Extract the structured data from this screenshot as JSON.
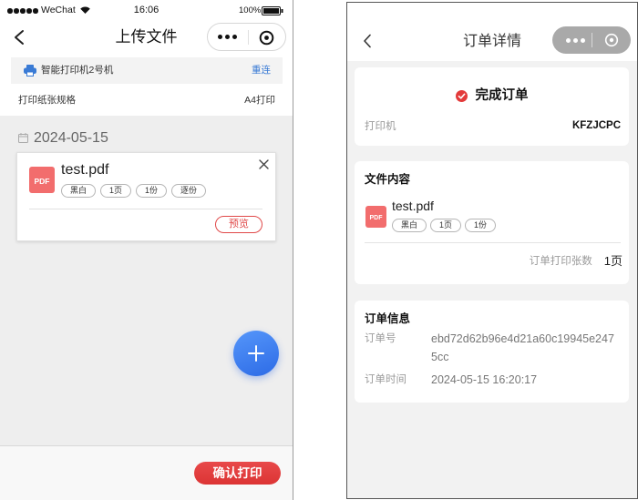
{
  "colors": {
    "accent_blue": "#3a7bd5",
    "fab_blue": "#2d6be6",
    "danger_red": "#e04848",
    "pdf_red": "#f26d6d",
    "page_bg": "#eeeeee",
    "card_bg": "#ffffff",
    "capsule_gray": "#a9a9a9"
  },
  "icons": {
    "signal": "signal-icon",
    "wifi": "wifi-icon",
    "battery": "battery-icon",
    "back": "chevron-left-icon",
    "more": "more-dots-icon",
    "exit": "capsule-exit-icon",
    "printer": "printer-icon",
    "calendar": "calendar-icon",
    "file": "pdf-file-icon",
    "close": "close-icon",
    "add": "plus-icon",
    "status": "check-circle-icon"
  },
  "upload_screen": {
    "status_bar": {
      "carrier": "WeChat",
      "time": "16:06",
      "battery": "100%"
    },
    "nav": {
      "title": "上传文件"
    },
    "printer": {
      "name": "智能打印机2号机",
      "reconnect": "重连"
    },
    "paper": {
      "label": "打印纸张规格",
      "value": "A4打印"
    },
    "file_group": {
      "date": "2024-05-15",
      "files": [
        {
          "name": "test.pdf",
          "type": "PDF",
          "tags": [
            "黑白",
            "1页",
            "1份",
            "逐份"
          ],
          "preview": "预览"
        }
      ]
    },
    "confirm": "确认打印"
  },
  "order_screen": {
    "nav": {
      "title": "订单详情"
    },
    "status": "完成订单",
    "printer": {
      "label": "打印机",
      "value": "KFZJCPC"
    },
    "file_content": {
      "title": "文件内容",
      "file": {
        "name": "test.pdf",
        "type": "PDF",
        "tags": [
          "黑白",
          "1页",
          "1份"
        ]
      },
      "sheets": {
        "label": "订单打印张数",
        "value": "1页"
      }
    },
    "order_info": {
      "title": "订单信息",
      "order_no": {
        "label": "订单号",
        "value": "ebd72d62b96e4d21a60c19945e2475cc"
      },
      "order_time": {
        "label": "订单时间",
        "value": "2024-05-15 16:20:17"
      }
    }
  }
}
